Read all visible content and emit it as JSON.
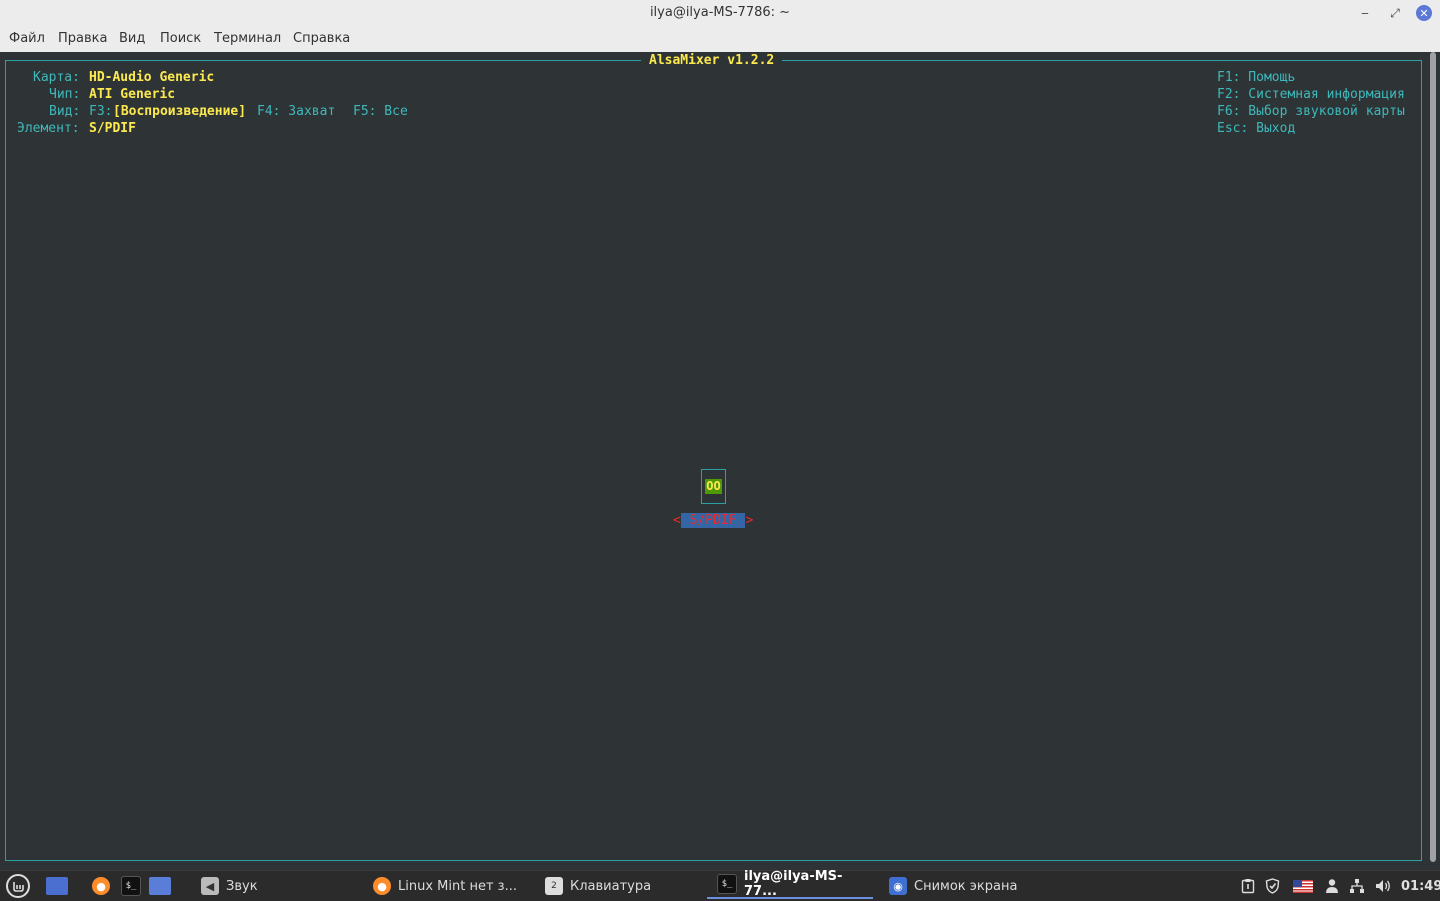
{
  "window": {
    "title": "ilya@ilya-MS-7786: ~",
    "minimize_glyph": "‒",
    "maximize_glyph": "⤢",
    "close_glyph": "✕"
  },
  "menu": [
    "Файл",
    "Правка",
    "Вид",
    "Поиск",
    "Терминал",
    "Справка"
  ],
  "alsamixer": {
    "title": "AlsaMixer v1.2.2",
    "card_label": "Карта:",
    "card_value": "HD-Audio Generic",
    "chip_label": "Чип:",
    "chip_value": "ATI Generic",
    "view_label": "Вид:",
    "view_f3": "F3:",
    "view_f3_value": "[Воспроизведение]",
    "view_f4": "F4: Захват",
    "view_f5": "F5: Все",
    "item_label": "Элемент:",
    "item_value": "S/PDIF",
    "help": [
      "F1: Помощь",
      "F2: Системная информация",
      "F6: Выбор звуковой карты",
      "Esc: Выход"
    ],
    "control": {
      "state": "OO",
      "arrow_left": "<",
      "name": " S/PDIF ",
      "arrow_right": ">"
    }
  },
  "taskbar": {
    "menu_icon": "mint-logo-icon",
    "launchers": [
      "show-desktop-icon",
      "firefox-icon",
      "terminal-icon",
      "files-icon"
    ],
    "windows": [
      {
        "label": "Звук",
        "icon": "sound-icon"
      },
      {
        "label": "Linux Mint нет з...",
        "icon": "firefox-icon"
      },
      {
        "label": "Клавиатура",
        "icon": "keyboard-icon"
      },
      {
        "label": "ilya@ilya-MS-77...",
        "icon": "terminal-icon",
        "active": true
      },
      {
        "label": "Снимок экрана",
        "icon": "screenshot-icon"
      }
    ],
    "clock": "01:49"
  },
  "colors": {
    "terminal_bg": "#2e3436",
    "cyan": "#3eb8bb",
    "yellow": "#fce94f",
    "red": "#ef2929",
    "highlight_blue": "#3465a4",
    "green": "#4e9a06"
  }
}
